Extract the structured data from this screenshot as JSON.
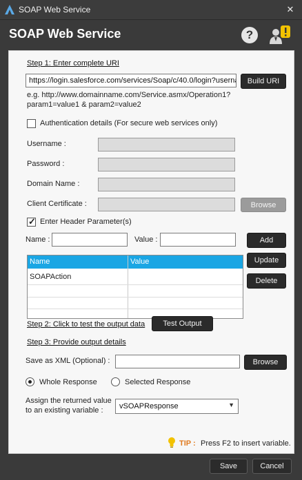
{
  "window": {
    "title": "SOAP Web Service",
    "close_glyph": "✕"
  },
  "header": {
    "heading": "SOAP Web Service",
    "help_glyph": "?"
  },
  "step1": {
    "label": "Step 1: Enter complete URI",
    "uri_value": "https://login.salesforce.com/services/Soap/c/40.0/login?userna",
    "build_button": "Build URI",
    "example_line1": "e.g. http://www.domainname.com/Service.asmx/Operation1?",
    "example_line2": "param1=value1 & param2=value2"
  },
  "auth": {
    "checkbox_label": "Authentication details (For secure web services only)",
    "checked": false,
    "username_label": "Username :",
    "password_label": "Password :",
    "domain_label": "Domain Name :",
    "certificate_label": "Client Certificate :",
    "browse_button": "Browse"
  },
  "headers": {
    "checkbox_label": "Enter Header Parameter(s)",
    "checked": true,
    "name_label": "Name :",
    "value_label": "Value :",
    "name_value": "",
    "value_value": "",
    "add_button": "Add",
    "update_button": "Update",
    "delete_button": "Delete",
    "columns": [
      "Name",
      "Value"
    ],
    "rows": [
      {
        "name": "SOAPAction",
        "value": ""
      }
    ]
  },
  "step2": {
    "label": "Step 2: Click to test the output data",
    "test_button": "Test Output"
  },
  "step3": {
    "label": "Step 3: Provide output details",
    "save_xml_label": "Save as XML (Optional) :",
    "save_xml_value": "",
    "browse_button": "Browse",
    "whole_response": "Whole Response",
    "selected_response": "Selected Response",
    "selected_option": "Whole Response",
    "assign_line1": "Assign the returned value",
    "assign_line2": "to an existing variable :",
    "variable": "vSOAPResponse"
  },
  "tip": {
    "label": "TIP :",
    "text": "Press F2 to insert variable."
  },
  "footer": {
    "save_button": "Save",
    "cancel_button": "Cancel"
  },
  "colors": {
    "grid_header": "#1aa6e4",
    "tip_label": "#e07a1f",
    "warning_badge": "#f2c200"
  }
}
